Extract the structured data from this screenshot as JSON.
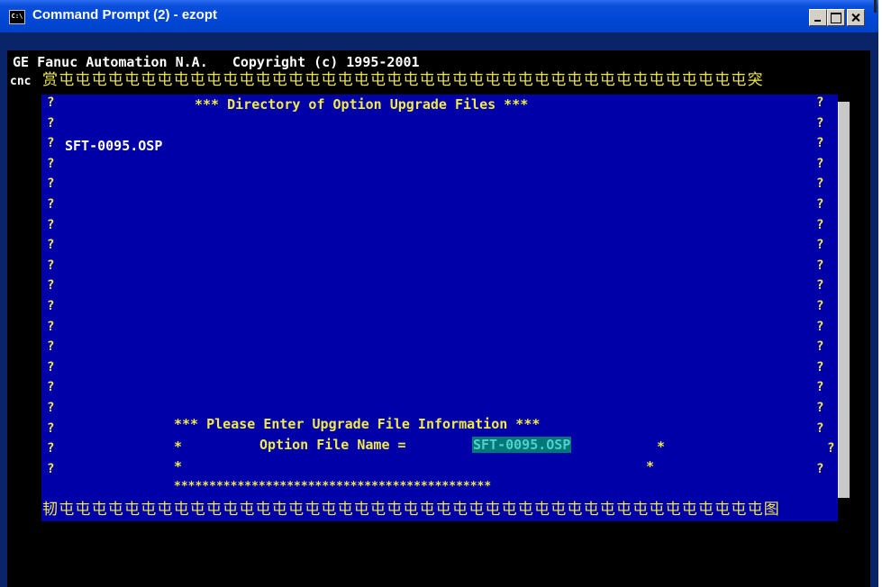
{
  "window": {
    "title": "Command Prompt (2) - ezopt",
    "icon": "C:\\"
  },
  "console": {
    "header_line": "GE Fanuc Automation N.A.   Copyright (c) 1995-2001",
    "top_border_prefix": "cnc",
    "top_border": "赏屯屯屯屯屯屯屯屯屯屯屯屯屯屯屯屯屯屯屯屯屯屯屯屯屯屯屯屯屯屯屯屯屯屯屯屯屯屯屯屯屯屯突",
    "bottom_border": "韧屯屯屯屯屯屯屯屯屯屯屯屯屯屯屯屯屯屯屯屯屯屯屯屯屯屯屯屯屯屯屯屯屯屯屯屯屯屯屯屯屯屯屯图",
    "side_char": "?",
    "directory_title": "*** Directory of Option Upgrade Files ***",
    "files": [
      "SFT-0095.OSP"
    ],
    "prompt_title": "*** Please Enter Upgrade File Information ***",
    "field_label": "Option File Name = ",
    "field_value": "SFT-0095.OSP",
    "star": "*",
    "star_rule": "*********************************************"
  }
}
